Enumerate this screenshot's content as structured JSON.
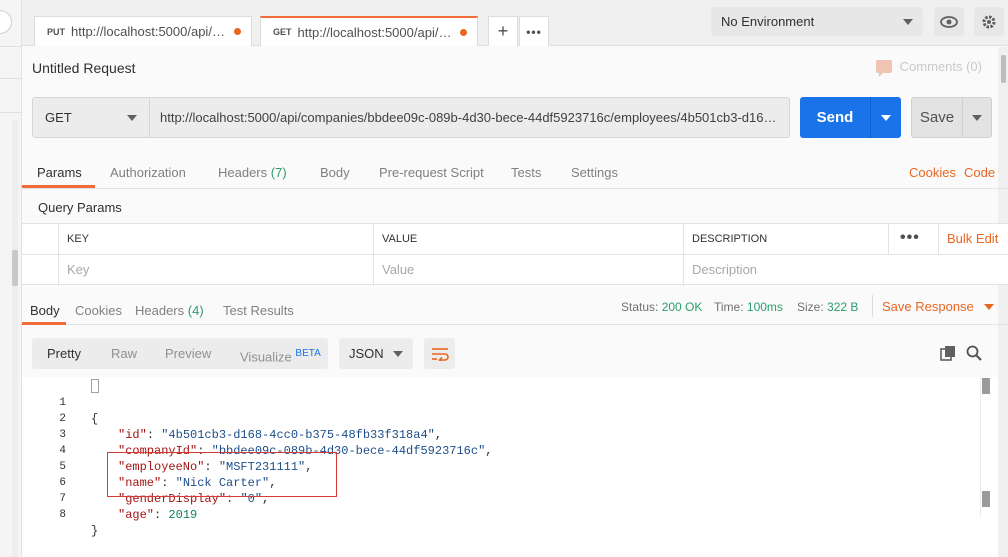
{
  "tabs": [
    {
      "method": "PUT",
      "url": "http://localhost:5000/api/comp..."
    },
    {
      "method": "GET",
      "url": "http://localhost:5000/api/comp..."
    }
  ],
  "tab_controls": {
    "add": "+",
    "more": "•••"
  },
  "environment": {
    "selected": "No Environment"
  },
  "request": {
    "title": "Untitled Request",
    "comments_label": "Comments (0)",
    "method": "GET",
    "url": "http://localhost:5000/api/companies/bbdee09c-089b-4d30-bece-44df5923716c/employees/4b501cb3-d168-...",
    "send_label": "Send",
    "save_label": "Save"
  },
  "request_tabs": {
    "params": "Params",
    "authorization": "Authorization",
    "headers": "Headers",
    "headers_count": "(7)",
    "body": "Body",
    "prerequest": "Pre-request Script",
    "tests": "Tests",
    "settings": "Settings",
    "cookies": "Cookies",
    "code": "Code"
  },
  "query_params": {
    "heading": "Query Params",
    "columns": {
      "key": "KEY",
      "value": "VALUE",
      "description": "DESCRIPTION"
    },
    "placeholders": {
      "key": "Key",
      "value": "Value",
      "description": "Description"
    },
    "more": "•••",
    "bulk_edit": "Bulk Edit"
  },
  "response_tabs": {
    "body": "Body",
    "cookies": "Cookies",
    "headers": "Headers",
    "headers_count": "(4)",
    "test_results": "Test Results"
  },
  "response_status": {
    "status_label": "Status:",
    "status_value": "200 OK",
    "time_label": "Time:",
    "time_value": "100ms",
    "size_label": "Size:",
    "size_value": "322 B",
    "save_response": "Save Response"
  },
  "body_toolbar": {
    "pretty": "Pretty",
    "raw": "Raw",
    "preview": "Preview",
    "visualize": "Visualize",
    "beta": "BETA",
    "format": "JSON"
  },
  "response_body": {
    "line_numbers": [
      "1",
      "2",
      "3",
      "4",
      "5",
      "6",
      "7",
      "8"
    ],
    "open_brace": "{",
    "close_brace": "}",
    "fields": [
      {
        "key": "\"id\"",
        "value": "\"4b501cb3-d168-4cc0-b375-48fb33f318a4\"",
        "trail": ","
      },
      {
        "key": "\"companyId\"",
        "value": "\"bbdee09c-089b-4d30-bece-44df5923716c\"",
        "trail": ","
      },
      {
        "key": "\"employeeNo\"",
        "value": "\"MSFT231111\"",
        "trail": ","
      },
      {
        "key": "\"name\"",
        "value": "\"Nick Carter\"",
        "trail": ","
      },
      {
        "key": "\"genderDisplay\"",
        "value": "\"0\"",
        "trail": ","
      },
      {
        "key": "\"age\"",
        "value": "2019",
        "trail": ""
      }
    ]
  },
  "colors": {
    "accent_orange": "#f26b3a",
    "send_blue": "#1a73e8",
    "status_green": "#2a9d6e",
    "highlight_red": "#d43a3a"
  }
}
